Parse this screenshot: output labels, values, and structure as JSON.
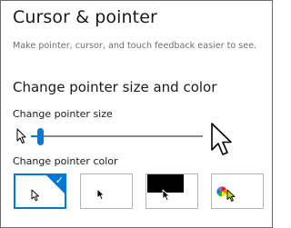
{
  "page": {
    "title": "Cursor & pointer",
    "subtitle": "Make pointer, cursor, and touch feedback easier to see."
  },
  "section": {
    "title": "Change pointer size and color"
  },
  "pointer_size": {
    "label": "Change pointer size",
    "slider_value_fraction": 0.02
  },
  "pointer_color": {
    "label": "Change pointer color",
    "options": [
      {
        "name": "white",
        "selected": true,
        "icon": "white-pointer-icon"
      },
      {
        "name": "black",
        "selected": false,
        "icon": "black-pointer-icon"
      },
      {
        "name": "inverted",
        "selected": false,
        "icon": "inverted-pointer-icon"
      },
      {
        "name": "custom",
        "selected": false,
        "icon": "custom-color-pointer-icon"
      }
    ]
  },
  "colors": {
    "accent": "#0078d7",
    "custom_pointer": "#b4e600"
  }
}
